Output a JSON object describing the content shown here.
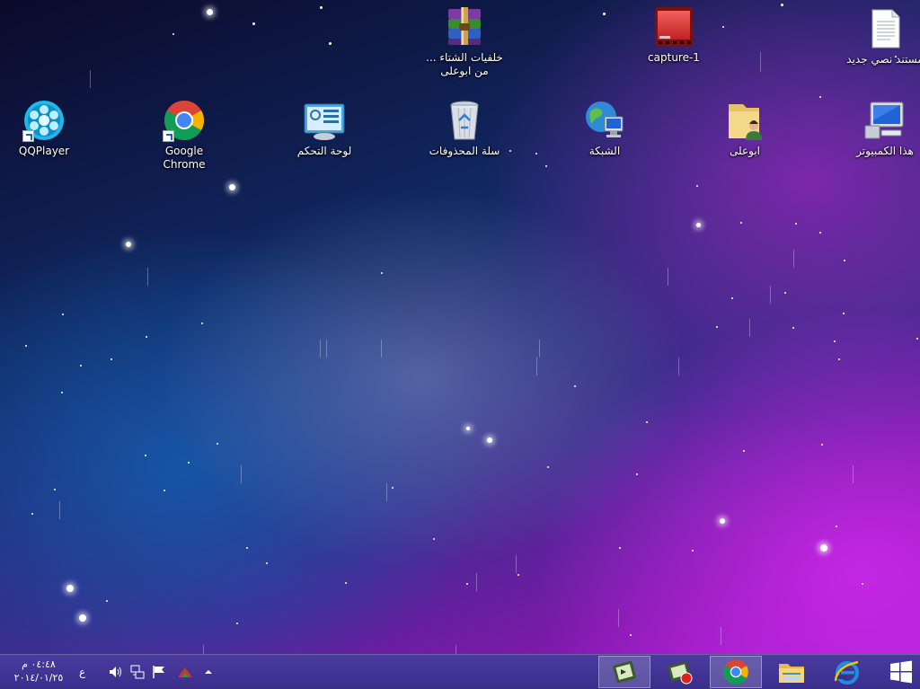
{
  "desktop": {
    "icons": [
      {
        "id": "new-text-doc",
        "label": "مستند نصي جديد"
      },
      {
        "id": "capture",
        "label": "capture-1"
      },
      {
        "id": "winter-wallpapers",
        "label": "خلفيات الشتاء ... من ابوعلى"
      },
      {
        "id": "this-computer",
        "label": "هذا الكمبيوتر"
      },
      {
        "id": "abouali-folder",
        "label": "ابوعلى"
      },
      {
        "id": "network",
        "label": "الشبكة"
      },
      {
        "id": "recycle-bin",
        "label": "سلة المحذوفات"
      },
      {
        "id": "control-panel",
        "label": "لوحة التحكم"
      },
      {
        "id": "google-chrome",
        "label": "Google Chrome"
      },
      {
        "id": "qqplayer",
        "label": "QQPlayer"
      }
    ]
  },
  "taskbar": {
    "clock_time": "٠٤:٤٨ م",
    "clock_date": "٢٠١٤/٠١/٢٥",
    "language": "ع",
    "tray_icons": [
      "volume-icon",
      "network-icon",
      "action-center-flag-icon",
      "app-tray-icon",
      "show-hidden-icons-icon"
    ],
    "pinned": [
      "start-button",
      "internet-explorer",
      "file-explorer",
      "google-chrome",
      "camtasia-recorder",
      "camtasia-studio"
    ]
  },
  "colors": {
    "taskbar": "#3b2e8a",
    "accent_chrome_red": "#db4437",
    "accent_chrome_green": "#0f9d58",
    "accent_chrome_yellow": "#f4b400",
    "accent_chrome_blue": "#4285f4"
  }
}
